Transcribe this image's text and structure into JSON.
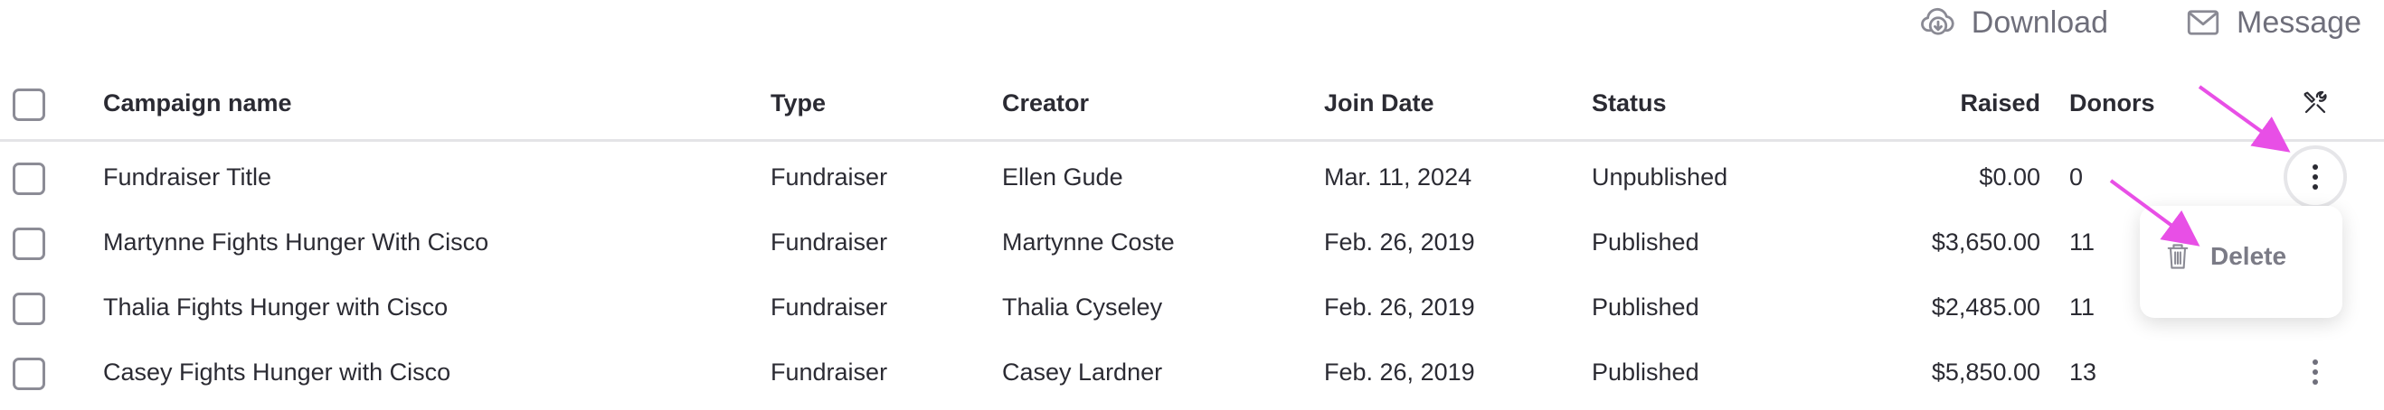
{
  "toolbar": {
    "download_label": "Download",
    "message_label": "Message",
    "download_icon": "cloud-download-icon",
    "message_icon": "envelope-icon"
  },
  "table": {
    "columns": {
      "campaign_name": "Campaign name",
      "type": "Type",
      "creator": "Creator",
      "join_date": "Join Date",
      "status": "Status",
      "raised": "Raised",
      "donors": "Donors",
      "settings_icon": "tools-icon"
    },
    "rows": [
      {
        "campaign_name": "Fundraiser Title",
        "type": "Fundraiser",
        "creator": "Ellen Gude",
        "join_date": "Mar. 11, 2024",
        "status": "Unpublished",
        "raised": "$0.00",
        "donors": "0"
      },
      {
        "campaign_name": "Martynne Fights Hunger With Cisco",
        "type": "Fundraiser",
        "creator": "Martynne Coste",
        "join_date": "Feb. 26, 2019",
        "status": "Published",
        "raised": "$3,650.00",
        "donors": "11"
      },
      {
        "campaign_name": "Thalia Fights Hunger with Cisco",
        "type": "Fundraiser",
        "creator": "Thalia Cyseley",
        "join_date": "Feb. 26, 2019",
        "status": "Published",
        "raised": "$2,485.00",
        "donors": "11"
      },
      {
        "campaign_name": "Casey Fights Hunger with Cisco",
        "type": "Fundraiser",
        "creator": "Casey Lardner",
        "join_date": "Feb. 26, 2019",
        "status": "Published",
        "raised": "$5,850.00",
        "donors": "13"
      }
    ]
  },
  "row_menu": {
    "delete_label": "Delete",
    "delete_icon": "trash-icon"
  },
  "colors": {
    "annotation_arrow": "#e84fe6",
    "muted_text": "#6f6f7b"
  }
}
